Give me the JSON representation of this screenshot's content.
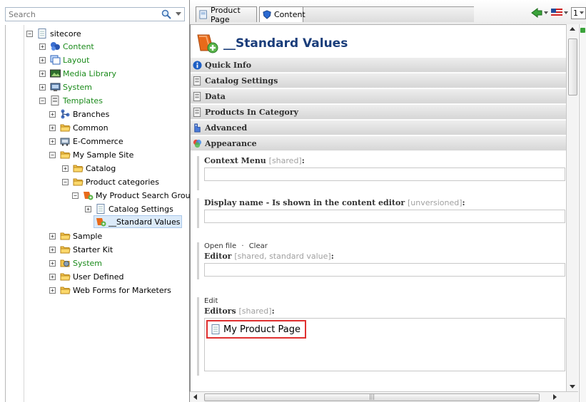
{
  "search": {
    "placeholder": "Search"
  },
  "tree": {
    "root": "sitecore",
    "content": "Content",
    "layout": "Layout",
    "media_library": "Media Library",
    "system": "System",
    "templates": "Templates",
    "branches": "Branches",
    "common": "Common",
    "ecommerce": "E-Commerce",
    "my_sample_site": "My Sample Site",
    "catalog": "Catalog",
    "product_categories": "Product categories",
    "my_product_search_group": "My Product Search Group",
    "catalog_settings": "Catalog Settings",
    "standard_values": "__Standard Values",
    "sample": "Sample",
    "starter_kit": "Starter Kit",
    "system2": "System",
    "user_defined": "User Defined",
    "web_forms": "Web Forms for Marketers"
  },
  "tabs": {
    "product_page": "Product Page",
    "content": "Content",
    "language_num": "1"
  },
  "editor": {
    "title": "__Standard Values",
    "sections": {
      "quick_info": "Quick Info",
      "catalog_settings": "Catalog Settings",
      "data": "Data",
      "products_in_category": "Products In Category",
      "advanced": "Advanced",
      "appearance": "Appearance"
    },
    "fields": {
      "context_menu": "Context Menu",
      "context_menu_hint": "[shared]",
      "display_name": "Display name - Is shown in the content editor",
      "display_name_hint": "[unversioned]",
      "open_file": "Open file",
      "clear": "Clear",
      "editor": "Editor",
      "editor_hint": "[shared, standard value]",
      "edit": "Edit",
      "editors": "Editors",
      "editors_hint": "[shared]",
      "colon": ":",
      "dot": "·",
      "list_item": "My Product Page"
    }
  },
  "colors": {
    "title": "#1a3d7a",
    "highlight_border": "#e03030",
    "green_label": "#1a8a1a",
    "selected_bg": "#dbeaf9"
  },
  "icons": {
    "search": "search-icon",
    "page": "page-icon",
    "folder": "folder-icon",
    "template": "template-icon",
    "info": "info-icon"
  }
}
